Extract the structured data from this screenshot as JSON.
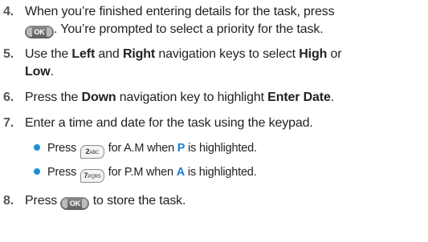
{
  "steps": [
    {
      "number": "4.",
      "line1": "When you’re finished entering details for the task, press",
      "key_label": "OK",
      "line2_after_key": ". You’re prompted to select a priority for the task."
    },
    {
      "number": "5.",
      "text_a": "Use the ",
      "bold_a": "Left",
      "text_b": " and ",
      "bold_b": "Right",
      "text_c": " navigation keys to select ",
      "bold_c": "High",
      "text_d": " or",
      "bold_d": "Low",
      "text_e": "."
    },
    {
      "number": "6.",
      "text_a": "Press the ",
      "bold_a": "Down",
      "text_b": " navigation key to highlight ",
      "bold_b": "Enter Date",
      "text_c": "."
    },
    {
      "number": "7.",
      "text": "Enter a time and date for the task using the keypad.",
      "bullets": [
        {
          "prefix": "Press ",
          "key_main": "2",
          "key_sub": "ABC",
          "mid": " for A.M when ",
          "highlight": "P",
          "suffix": " is highlighted."
        },
        {
          "prefix": "Press ",
          "key_main": "7",
          "key_sub": "PQRS",
          "mid": " for P.M when ",
          "highlight": "A",
          "suffix": " is highlighted."
        }
      ]
    },
    {
      "number": "8.",
      "text_a": "Press ",
      "key_label": "OK",
      "text_b": " to store the task."
    }
  ],
  "colors": {
    "accent_blue": "#1a7fd6",
    "step_number_gray": "#555555",
    "body_text": "#222222"
  },
  "icons": [
    "ok-key-icon",
    "key-2-abc-icon",
    "key-7-pqrs-icon",
    "bullet-icon"
  ]
}
